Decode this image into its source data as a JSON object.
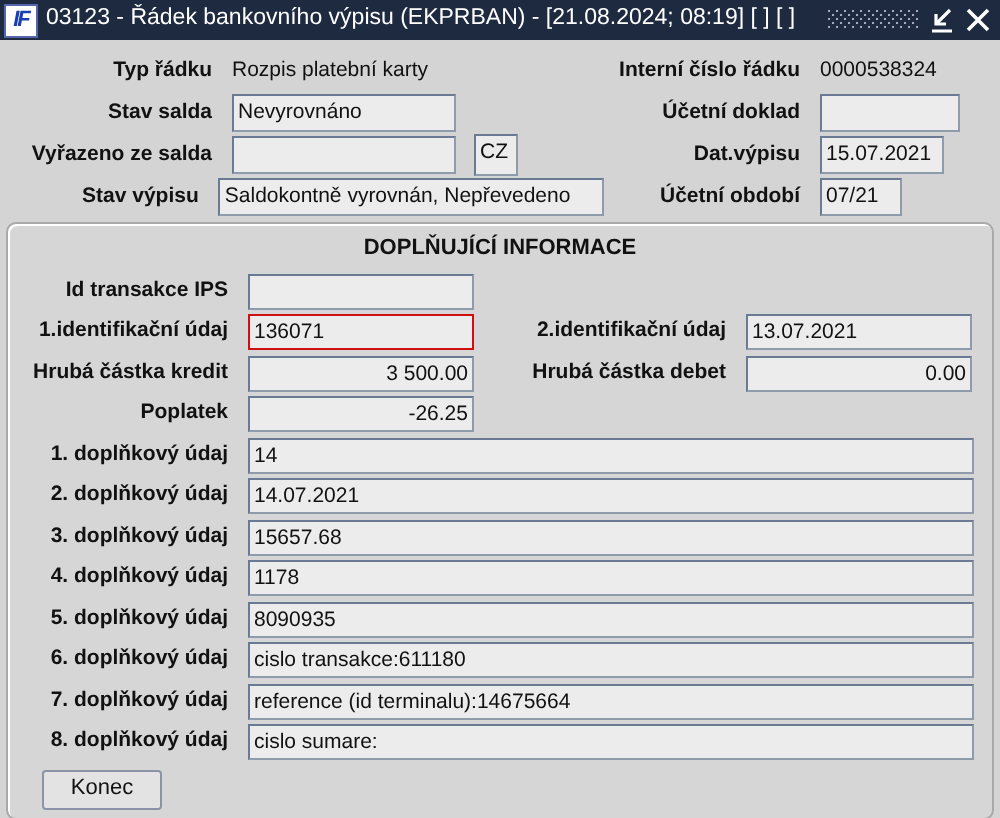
{
  "window": {
    "logo": "IF",
    "title": "03123 - Řádek bankovního výpisu (EKPRBAN) - [21.08.2024; 08:19] [ ] [ ]"
  },
  "header_rows": [
    {
      "left": {
        "label": "Typ řádku",
        "kind": "text",
        "value": "Rozpis platební karty"
      },
      "right": {
        "label": "Interní číslo řádku",
        "kind": "text",
        "value": "0000538324"
      }
    },
    {
      "left": {
        "label": "Stav salda",
        "kind": "field",
        "value": "Nevyrovnáno"
      },
      "right": {
        "label": "Účetní doklad",
        "kind": "field"
      }
    },
    {
      "left": {
        "label": "Vyřazeno ze salda",
        "kind": "field"
      },
      "currency": "CZ",
      "right": {
        "label": "Dat.výpisu",
        "kind": "field",
        "value": "15.07.2021"
      }
    },
    {
      "left": {
        "label": "Stav výpisu",
        "kind": "wide",
        "value": "Saldokontně vyrovnán, Nepřevedeno"
      },
      "right": {
        "label": "Účetní období",
        "kind": "short",
        "value": "07/21"
      }
    }
  ],
  "panel": {
    "title": "DOPLŇUJÍCÍ INFORMACE",
    "rows": [
      {
        "left": {
          "label": "Id transakce IPS",
          "kind": "text",
          "focused": false
        }
      },
      {
        "left": {
          "label": "1.identifikační údaj",
          "kind": "text",
          "value": "136071",
          "focused": true
        },
        "right": {
          "label": "2.identifikační údaj",
          "kind": "text",
          "value": "13.07.2021",
          "focused": false
        }
      },
      {
        "left": {
          "label": "Hrubá částka kredit",
          "kind": "amount",
          "value": "3 500.00",
          "focused": false
        },
        "right": {
          "label": "Hrubá částka debet",
          "kind": "amount",
          "value": "0.00",
          "focused": false
        }
      },
      {
        "left": {
          "label": "Poplatek",
          "kind": "amount",
          "value": "-26.25",
          "focused": false
        }
      }
    ],
    "extra_fields": [
      {
        "label": "1. doplňkový údaj",
        "value": "14"
      },
      {
        "label": "2. doplňkový údaj",
        "value": "14.07.2021"
      },
      {
        "label": "3. doplňkový údaj",
        "value": "15657.68"
      },
      {
        "label": "4. doplňkový údaj",
        "value": "1178"
      },
      {
        "label": "5. doplňkový údaj",
        "value": "8090935"
      },
      {
        "label": "6. doplňkový údaj",
        "value": "cislo transakce:611180"
      },
      {
        "label": "7. doplňkový údaj",
        "value": "reference (id terminalu):14675664"
      },
      {
        "label": "8. doplňkový údaj",
        "value": "cislo sumare:"
      }
    ],
    "buttons": [
      {
        "label": "Konec"
      }
    ]
  }
}
